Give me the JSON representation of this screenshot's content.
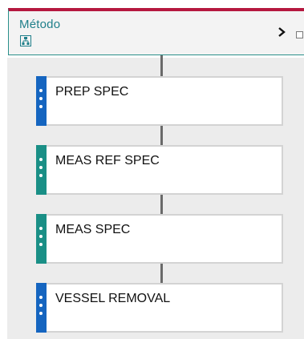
{
  "method": {
    "title": "Método",
    "icon": "method-tree-icon",
    "chevron": "›",
    "accent_color": "#b5183f",
    "title_color": "#1f7f8a"
  },
  "steps": [
    {
      "label": "PREP SPEC",
      "color": "#1565c0"
    },
    {
      "label": "MEAS REF SPEC",
      "color": "#1a8f86"
    },
    {
      "label": "MEAS SPEC",
      "color": "#1a8f86"
    },
    {
      "label": "VESSEL REMOVAL",
      "color": "#1565c0"
    }
  ]
}
